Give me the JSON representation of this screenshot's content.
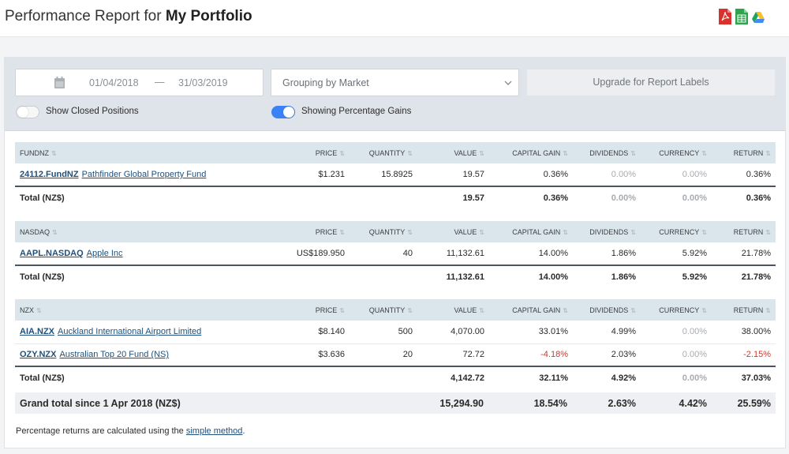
{
  "header": {
    "title_prefix": "Performance Report for ",
    "portfolio_name": "My Portfolio",
    "export_icons": [
      "pdf-icon",
      "spreadsheet-icon",
      "google-drive-icon"
    ]
  },
  "filters": {
    "start_date": "01/04/2018",
    "date_separator": "—",
    "end_date": "31/03/2019",
    "grouping": "Grouping by Market",
    "upgrade_label": "Upgrade for Report Labels",
    "show_closed_label": "Show Closed Positions",
    "show_closed_on": false,
    "percentage_label": "Showing Percentage Gains",
    "percentage_on": true
  },
  "columns": [
    "PRICE",
    "QUANTITY",
    "VALUE",
    "CAPITAL GAIN",
    "DIVIDENDS",
    "CURRENCY",
    "RETURN"
  ],
  "groups": [
    {
      "market": "FUNDNZ",
      "rows": [
        {
          "code": "24112.FundNZ",
          "name": "Pathfinder Global Property Fund",
          "price": "$1.231",
          "quantity": "15.8925",
          "value": "19.57",
          "capital_gain": "0.36%",
          "dividends": "0.00%",
          "currency": "0.00%",
          "return": "0.36%"
        }
      ],
      "total": {
        "label": "Total (NZ$)",
        "value": "19.57",
        "capital_gain": "0.36%",
        "dividends": "0.00%",
        "currency": "0.00%",
        "return": "0.36%"
      }
    },
    {
      "market": "NASDAQ",
      "rows": [
        {
          "code": "AAPL.NASDAQ",
          "name": "Apple Inc",
          "price": "US$189.950",
          "quantity": "40",
          "value": "11,132.61",
          "capital_gain": "14.00%",
          "dividends": "1.86%",
          "currency": "5.92%",
          "return": "21.78%"
        }
      ],
      "total": {
        "label": "Total (NZ$)",
        "value": "11,132.61",
        "capital_gain": "14.00%",
        "dividends": "1.86%",
        "currency": "5.92%",
        "return": "21.78%"
      }
    },
    {
      "market": "NZX",
      "rows": [
        {
          "code": "AIA.NZX",
          "name": "Auckland International Airport Limited",
          "price": "$8.140",
          "quantity": "500",
          "value": "4,070.00",
          "capital_gain": "33.01%",
          "dividends": "4.99%",
          "currency": "0.00%",
          "return": "38.00%"
        },
        {
          "code": "OZY.NZX",
          "name": "Australian Top 20 Fund (NS)",
          "price": "$3.636",
          "quantity": "20",
          "value": "72.72",
          "capital_gain": "-4.18%",
          "dividends": "2.03%",
          "currency": "0.00%",
          "return": "-2.15%"
        }
      ],
      "total": {
        "label": "Total (NZ$)",
        "value": "4,142.72",
        "capital_gain": "32.11%",
        "dividends": "4.92%",
        "currency": "0.00%",
        "return": "37.03%"
      }
    }
  ],
  "grand_total": {
    "label": "Grand total since 1 Apr 2018 (NZ$)",
    "value": "15,294.90",
    "capital_gain": "18.54%",
    "dividends": "2.63%",
    "currency": "4.42%",
    "return": "25.59%"
  },
  "footnote": {
    "text": "Percentage returns are calculated using the ",
    "link": "simple method",
    "end": "."
  },
  "colors": {
    "accent": "#3b82f6",
    "negative": "#d9342b",
    "link": "#1f4f7a",
    "header_row": "#dbe5ec"
  }
}
